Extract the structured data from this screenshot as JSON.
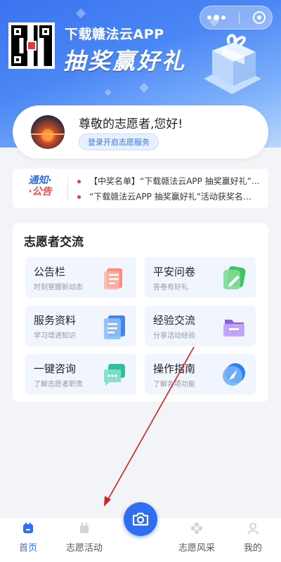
{
  "banner": {
    "title": "下载赣法云APP",
    "slogan": "抽奖赢好礼"
  },
  "profile": {
    "greeting": "尊敬的志愿者,您好!",
    "login_button": "登录开启志愿服务"
  },
  "notice": {
    "tag_line1": "通知·",
    "tag_line2": "·公告",
    "items": [
      "【中奖名单】“下载赣法云APP 抽奖赢好礼”…",
      "“下载赣法云APP 抽奖赢好礼”活动获奖名…"
    ]
  },
  "volunteer": {
    "title": "志愿者交流",
    "tiles": [
      {
        "title": "公告栏",
        "subtitle": "时刻掌握新动态",
        "icon": "bulletin-icon"
      },
      {
        "title": "平安问卷",
        "subtitle": "答卷有好礼",
        "icon": "survey-icon"
      },
      {
        "title": "服务资料",
        "subtitle": "学习增进知识",
        "icon": "document-icon"
      },
      {
        "title": "经验交流",
        "subtitle": "分享活动经验",
        "icon": "folder-icon"
      },
      {
        "title": "一键咨询",
        "subtitle": "了解志愿者职责",
        "icon": "chat-icon"
      },
      {
        "title": "操作指南",
        "subtitle": "了解各项功能",
        "icon": "compass-icon"
      }
    ]
  },
  "tabbar": {
    "home": "首页",
    "activities": "志愿活动",
    "style": "志愿风采",
    "mine": "我的"
  },
  "colors": {
    "accent": "#2f6ef0",
    "notice_red": "#f04848",
    "annotation": "#d62020"
  }
}
